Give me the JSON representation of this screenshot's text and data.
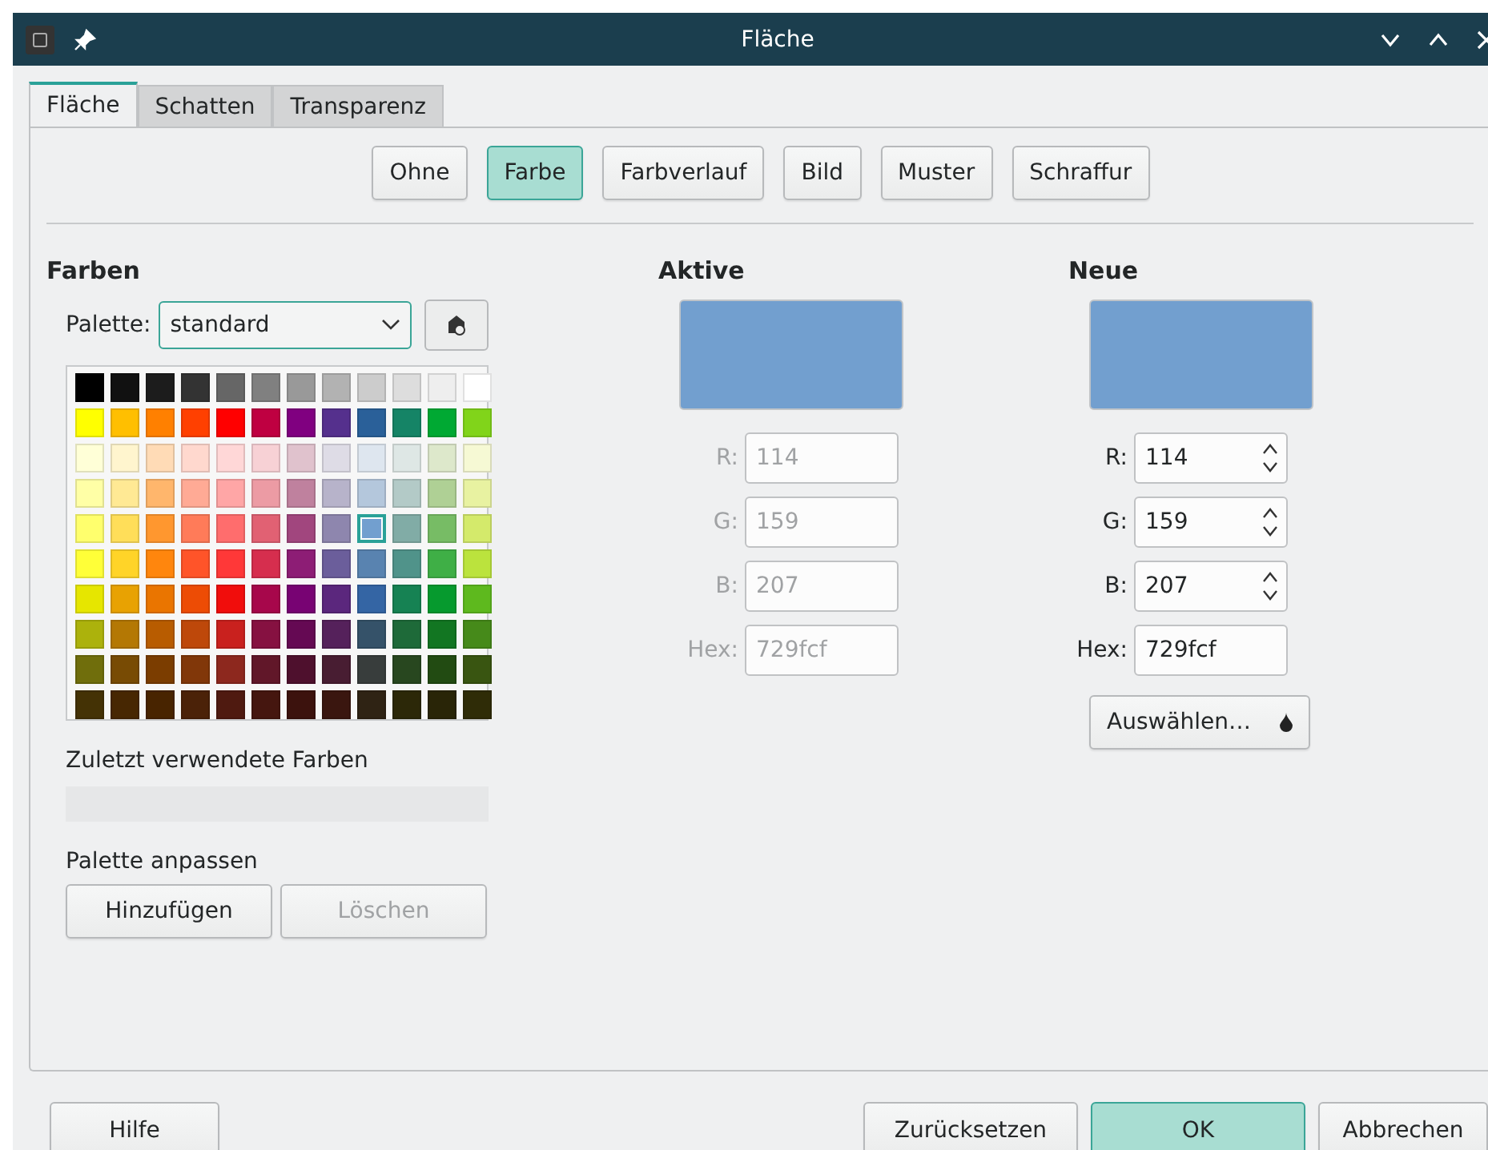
{
  "window": {
    "title": "Fläche"
  },
  "tabs": [
    {
      "label": "Fläche",
      "selected": true
    },
    {
      "label": "Schatten",
      "selected": false
    },
    {
      "label": "Transparenz",
      "selected": false
    }
  ],
  "fill_types": [
    {
      "label": "Ohne",
      "selected": false
    },
    {
      "label": "Farbe",
      "selected": true
    },
    {
      "label": "Farbverlauf",
      "selected": false
    },
    {
      "label": "Bild",
      "selected": false
    },
    {
      "label": "Muster",
      "selected": false
    },
    {
      "label": "Schraffur",
      "selected": false
    }
  ],
  "colors": {
    "heading": "Farben",
    "palette_label": "Palette:",
    "palette_value": "standard",
    "rows": [
      {
        "swatches": [
          {
            "color": "#000000",
            "selected": false
          },
          {
            "color": "#111111",
            "selected": false
          },
          {
            "color": "#1c1c1c",
            "selected": false
          },
          {
            "color": "#333333",
            "selected": false
          },
          {
            "color": "#666666",
            "selected": false
          },
          {
            "color": "#808080",
            "selected": false
          },
          {
            "color": "#999999",
            "selected": false
          },
          {
            "color": "#b2b2b2",
            "selected": false
          },
          {
            "color": "#cccccc",
            "selected": false
          },
          {
            "color": "#dddddd",
            "selected": false
          },
          {
            "color": "#eeeeee",
            "selected": false
          },
          {
            "color": "#ffffff",
            "selected": false
          }
        ]
      },
      {
        "swatches": [
          {
            "color": "#ffff00",
            "selected": false
          },
          {
            "color": "#ffbf00",
            "selected": false
          },
          {
            "color": "#ff8000",
            "selected": false
          },
          {
            "color": "#ff4000",
            "selected": false
          },
          {
            "color": "#ff0000",
            "selected": false
          },
          {
            "color": "#bf0041",
            "selected": false
          },
          {
            "color": "#800080",
            "selected": false
          },
          {
            "color": "#55308d",
            "selected": false
          },
          {
            "color": "#2a6099",
            "selected": false
          },
          {
            "color": "#158466",
            "selected": false
          },
          {
            "color": "#00a933",
            "selected": false
          },
          {
            "color": "#81d41a",
            "selected": false
          }
        ]
      },
      {
        "swatches": [
          {
            "color": "#ffffd7",
            "selected": false
          },
          {
            "color": "#fff5ce",
            "selected": false
          },
          {
            "color": "#ffdbb6",
            "selected": false
          },
          {
            "color": "#ffd8ce",
            "selected": false
          },
          {
            "color": "#ffd7d7",
            "selected": false
          },
          {
            "color": "#f7d1d5",
            "selected": false
          },
          {
            "color": "#e0c2cd",
            "selected": false
          },
          {
            "color": "#dedce6",
            "selected": false
          },
          {
            "color": "#dee6ef",
            "selected": false
          },
          {
            "color": "#dee7e5",
            "selected": false
          },
          {
            "color": "#dde8cb",
            "selected": false
          },
          {
            "color": "#f6f9d4",
            "selected": false
          }
        ]
      },
      {
        "swatches": [
          {
            "color": "#ffffa6",
            "selected": false
          },
          {
            "color": "#ffe994",
            "selected": false
          },
          {
            "color": "#ffb66c",
            "selected": false
          },
          {
            "color": "#ffaa95",
            "selected": false
          },
          {
            "color": "#ffa6a6",
            "selected": false
          },
          {
            "color": "#ec9ba4",
            "selected": false
          },
          {
            "color": "#bf819e",
            "selected": false
          },
          {
            "color": "#b7b3ca",
            "selected": false
          },
          {
            "color": "#b4c7dc",
            "selected": false
          },
          {
            "color": "#b3cac7",
            "selected": false
          },
          {
            "color": "#afd095",
            "selected": false
          },
          {
            "color": "#e8f2a1",
            "selected": false
          }
        ]
      },
      {
        "swatches": [
          {
            "color": "#ffff6d",
            "selected": false
          },
          {
            "color": "#ffde59",
            "selected": false
          },
          {
            "color": "#ff972f",
            "selected": false
          },
          {
            "color": "#ff7b59",
            "selected": false
          },
          {
            "color": "#ff6d6d",
            "selected": false
          },
          {
            "color": "#e16173",
            "selected": false
          },
          {
            "color": "#a1467e",
            "selected": false
          },
          {
            "color": "#8e86ae",
            "selected": false
          },
          {
            "color": "#729fcf",
            "selected": true
          },
          {
            "color": "#81aca6",
            "selected": false
          },
          {
            "color": "#77bc65",
            "selected": false
          },
          {
            "color": "#d4ea6b",
            "selected": false
          }
        ]
      },
      {
        "swatches": [
          {
            "color": "#ffff38",
            "selected": false
          },
          {
            "color": "#ffd428",
            "selected": false
          },
          {
            "color": "#ff860d",
            "selected": false
          },
          {
            "color": "#ff5429",
            "selected": false
          },
          {
            "color": "#ff3838",
            "selected": false
          },
          {
            "color": "#d62e4e",
            "selected": false
          },
          {
            "color": "#8d1d75",
            "selected": false
          },
          {
            "color": "#6b5e9b",
            "selected": false
          },
          {
            "color": "#5983b0",
            "selected": false
          },
          {
            "color": "#50938a",
            "selected": false
          },
          {
            "color": "#3faf46",
            "selected": false
          },
          {
            "color": "#bbe33d",
            "selected": false
          }
        ]
      },
      {
        "swatches": [
          {
            "color": "#e6e600",
            "selected": false
          },
          {
            "color": "#e8a202",
            "selected": false
          },
          {
            "color": "#ea7500",
            "selected": false
          },
          {
            "color": "#ed4c05",
            "selected": false
          },
          {
            "color": "#f10d0c",
            "selected": false
          },
          {
            "color": "#a7074b",
            "selected": false
          },
          {
            "color": "#780373",
            "selected": false
          },
          {
            "color": "#5b277d",
            "selected": false
          },
          {
            "color": "#3465a4",
            "selected": false
          },
          {
            "color": "#168253",
            "selected": false
          },
          {
            "color": "#069a2e",
            "selected": false
          },
          {
            "color": "#5eb91e",
            "selected": false
          }
        ]
      },
      {
        "swatches": [
          {
            "color": "#acb20c",
            "selected": false
          },
          {
            "color": "#b47804",
            "selected": false
          },
          {
            "color": "#b85c00",
            "selected": false
          },
          {
            "color": "#be480a",
            "selected": false
          },
          {
            "color": "#c9211e",
            "selected": false
          },
          {
            "color": "#861141",
            "selected": false
          },
          {
            "color": "#650953",
            "selected": false
          },
          {
            "color": "#55215b",
            "selected": false
          },
          {
            "color": "#355269",
            "selected": false
          },
          {
            "color": "#1e6a39",
            "selected": false
          },
          {
            "color": "#127622",
            "selected": false
          },
          {
            "color": "#468a1a",
            "selected": false
          }
        ]
      },
      {
        "swatches": [
          {
            "color": "#706e0c",
            "selected": false
          },
          {
            "color": "#784b04",
            "selected": false
          },
          {
            "color": "#7b3d00",
            "selected": false
          },
          {
            "color": "#813709",
            "selected": false
          },
          {
            "color": "#8d281e",
            "selected": false
          },
          {
            "color": "#611729",
            "selected": false
          },
          {
            "color": "#4e102d",
            "selected": false
          },
          {
            "color": "#481d32",
            "selected": false
          },
          {
            "color": "#383d3c",
            "selected": false
          },
          {
            "color": "#28471f",
            "selected": false
          },
          {
            "color": "#224b12",
            "selected": false
          },
          {
            "color": "#395511",
            "selected": false
          }
        ]
      },
      {
        "swatches": [
          {
            "color": "#443205",
            "selected": false
          },
          {
            "color": "#472702",
            "selected": false
          },
          {
            "color": "#482400",
            "selected": false
          },
          {
            "color": "#4b2208",
            "selected": false
          },
          {
            "color": "#4f1a10",
            "selected": false
          },
          {
            "color": "#45160f",
            "selected": false
          },
          {
            "color": "#3c120d",
            "selected": false
          },
          {
            "color": "#3a160f",
            "selected": false
          },
          {
            "color": "#2f2314",
            "selected": false
          },
          {
            "color": "#2c2808",
            "selected": false
          },
          {
            "color": "#292507",
            "selected": false
          },
          {
            "color": "#2f2c07",
            "selected": false
          }
        ]
      }
    ]
  },
  "recent": {
    "label": "Zuletzt verwendete Farben"
  },
  "custom_palette": {
    "label": "Palette anpassen",
    "buttons": [
      {
        "label": "Hinzufügen",
        "disabled": false
      },
      {
        "label": "Löschen",
        "disabled": true
      }
    ]
  },
  "active": {
    "heading": "Aktive",
    "color": "#729fcf",
    "disabled": true,
    "fields": [
      {
        "label": "R:",
        "value": "114"
      },
      {
        "label": "G:",
        "value": "159"
      },
      {
        "label": "B:",
        "value": "207"
      },
      {
        "label": "Hex:",
        "value": "729fcf"
      }
    ]
  },
  "new": {
    "heading": "Neue",
    "color": "#729fcf",
    "fields": [
      {
        "label": "R:",
        "value": "114",
        "kind": "spin"
      },
      {
        "label": "G:",
        "value": "159",
        "kind": "spin"
      },
      {
        "label": "B:",
        "value": "207",
        "kind": "spin"
      },
      {
        "label": "Hex:",
        "value": "729fcf",
        "kind": "text"
      }
    ],
    "pick_button": "Auswählen…"
  },
  "footer": [
    {
      "label": "Hilfe",
      "default": false
    },
    {
      "label": "Zurücksetzen",
      "default": false
    },
    {
      "label": "OK",
      "default": true
    },
    {
      "label": "Abbrechen",
      "default": false
    }
  ]
}
